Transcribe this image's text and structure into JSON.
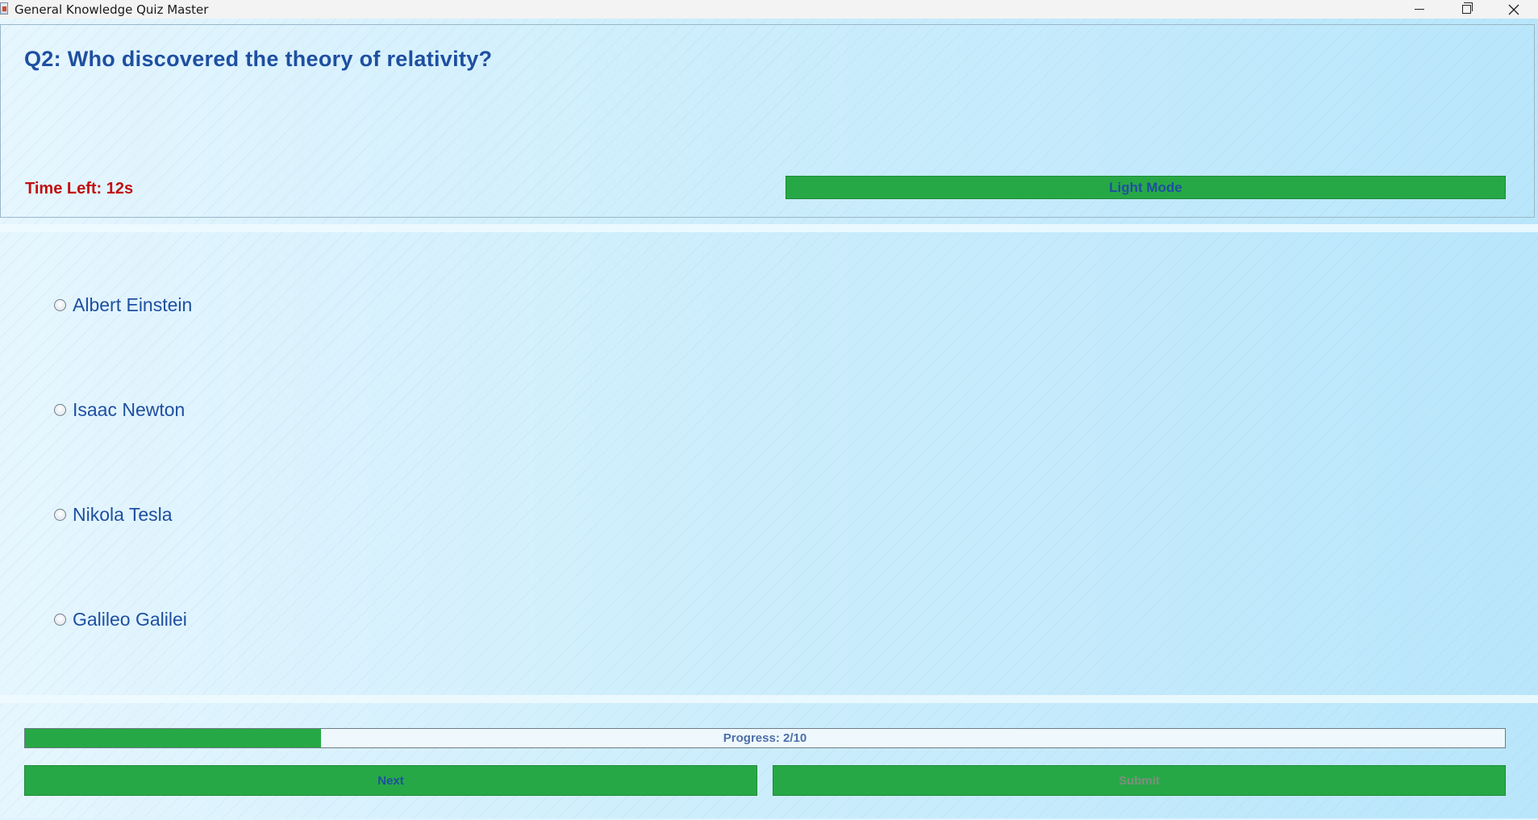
{
  "window": {
    "title": "General Knowledge Quiz Master"
  },
  "quiz": {
    "question": "Q2: Who discovered the theory of relativity?",
    "timer_label": "Time Left: 12s",
    "mode_button_label": "Light Mode",
    "options": [
      {
        "label": "Albert Einstein",
        "selected": false
      },
      {
        "label": "Isaac Newton",
        "selected": false
      },
      {
        "label": "Nikola Tesla",
        "selected": false
      },
      {
        "label": "Galileo Galilei",
        "selected": false
      }
    ],
    "progress": {
      "label": "Progress: 2/10",
      "current": 2,
      "total": 10,
      "fraction": 0.2
    },
    "next_label": "Next",
    "submit_label": "Submit",
    "submit_enabled": false
  },
  "colors": {
    "accent_green": "#27a846",
    "text_blue": "#1e4fa0",
    "timer_red": "#c20f0f",
    "background": "#cdeefc"
  },
  "icons": {
    "window_controls": [
      "minimize-icon",
      "restore-icon",
      "close-icon"
    ]
  }
}
